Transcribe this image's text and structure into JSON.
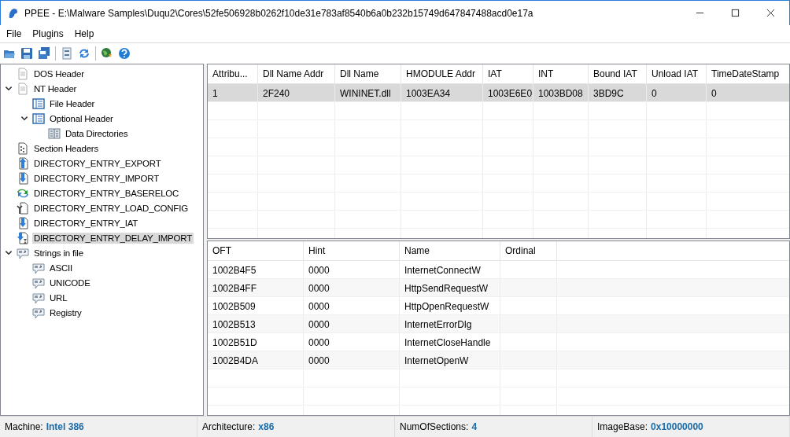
{
  "window": {
    "title": "PPEE - E:\\Malware Samples\\Duqu2\\Cores\\52fe506928b0262f10de31e783af8540b6a0b232b15749d647847488acd0e17a"
  },
  "menu": [
    "File",
    "Plugins",
    "Help"
  ],
  "tree": [
    {
      "label": "DOS Header",
      "kind": "page",
      "selected": false
    },
    {
      "label": "NT Header",
      "kind": "page",
      "selected": false,
      "expanded": true,
      "children": [
        {
          "label": "File Header",
          "kind": "header",
          "selected": false
        },
        {
          "label": "Optional Header",
          "kind": "header",
          "selected": false,
          "expanded": true,
          "children": [
            {
              "label": "Data Directories",
              "kind": "grid",
              "selected": false
            }
          ]
        }
      ]
    },
    {
      "label": "Section Headers",
      "kind": "section",
      "selected": false
    },
    {
      "label": "DIRECTORY_ENTRY_EXPORT",
      "kind": "export",
      "selected": false
    },
    {
      "label": "DIRECTORY_ENTRY_IMPORT",
      "kind": "import",
      "selected": false
    },
    {
      "label": "DIRECTORY_ENTRY_BASERELOC",
      "kind": "reloc",
      "selected": false
    },
    {
      "label": "DIRECTORY_ENTRY_LOAD_CONFIG",
      "kind": "config",
      "selected": false
    },
    {
      "label": "DIRECTORY_ENTRY_IAT",
      "kind": "import",
      "selected": false
    },
    {
      "label": "DIRECTORY_ENTRY_DELAY_IMPORT",
      "kind": "delay",
      "selected": true
    },
    {
      "label": "Strings in file",
      "kind": "strings",
      "selected": false,
      "expanded": true,
      "children": [
        {
          "label": "ASCII",
          "kind": "strings",
          "selected": false
        },
        {
          "label": "UNICODE",
          "kind": "strings",
          "selected": false
        },
        {
          "label": "URL",
          "kind": "strings",
          "selected": false
        },
        {
          "label": "Registry",
          "kind": "strings",
          "selected": false
        }
      ]
    }
  ],
  "dll_table": {
    "columns": [
      "Attribu...",
      "Dll Name Addr",
      "Dll Name",
      "HMODULE Addr",
      "IAT",
      "INT",
      "Bound IAT",
      "Unload IAT",
      "TimeDateStamp"
    ],
    "rows": [
      {
        "cells": [
          "1",
          "2F240",
          "WININET.dll",
          "1003EA34",
          "1003E6E0",
          "1003BD08",
          "3BD9C",
          "0",
          "0"
        ],
        "selected": true
      }
    ]
  },
  "func_table": {
    "columns": [
      "OFT",
      "Hint",
      "Name",
      "Ordinal"
    ],
    "rows": [
      {
        "cells": [
          "1002B4F5",
          "0000",
          "InternetConnectW"
        ]
      },
      {
        "cells": [
          "1002B4FF",
          "0000",
          "HttpSendRequestW"
        ]
      },
      {
        "cells": [
          "1002B509",
          "0000",
          "HttpOpenRequestW"
        ]
      },
      {
        "cells": [
          "1002B513",
          "0000",
          "InternetErrorDlg"
        ]
      },
      {
        "cells": [
          "1002B51D",
          "0000",
          "InternetCloseHandle"
        ]
      },
      {
        "cells": [
          "1002B4DA",
          "0000",
          "InternetOpenW"
        ]
      }
    ]
  },
  "status_bar": [
    {
      "label": "Machine:",
      "value": "Intel 386"
    },
    {
      "label": "Architecture:",
      "value": "x86"
    },
    {
      "label": "NumOfSections:",
      "value": "4"
    },
    {
      "label": "ImageBase:",
      "value": "0x10000000"
    }
  ]
}
